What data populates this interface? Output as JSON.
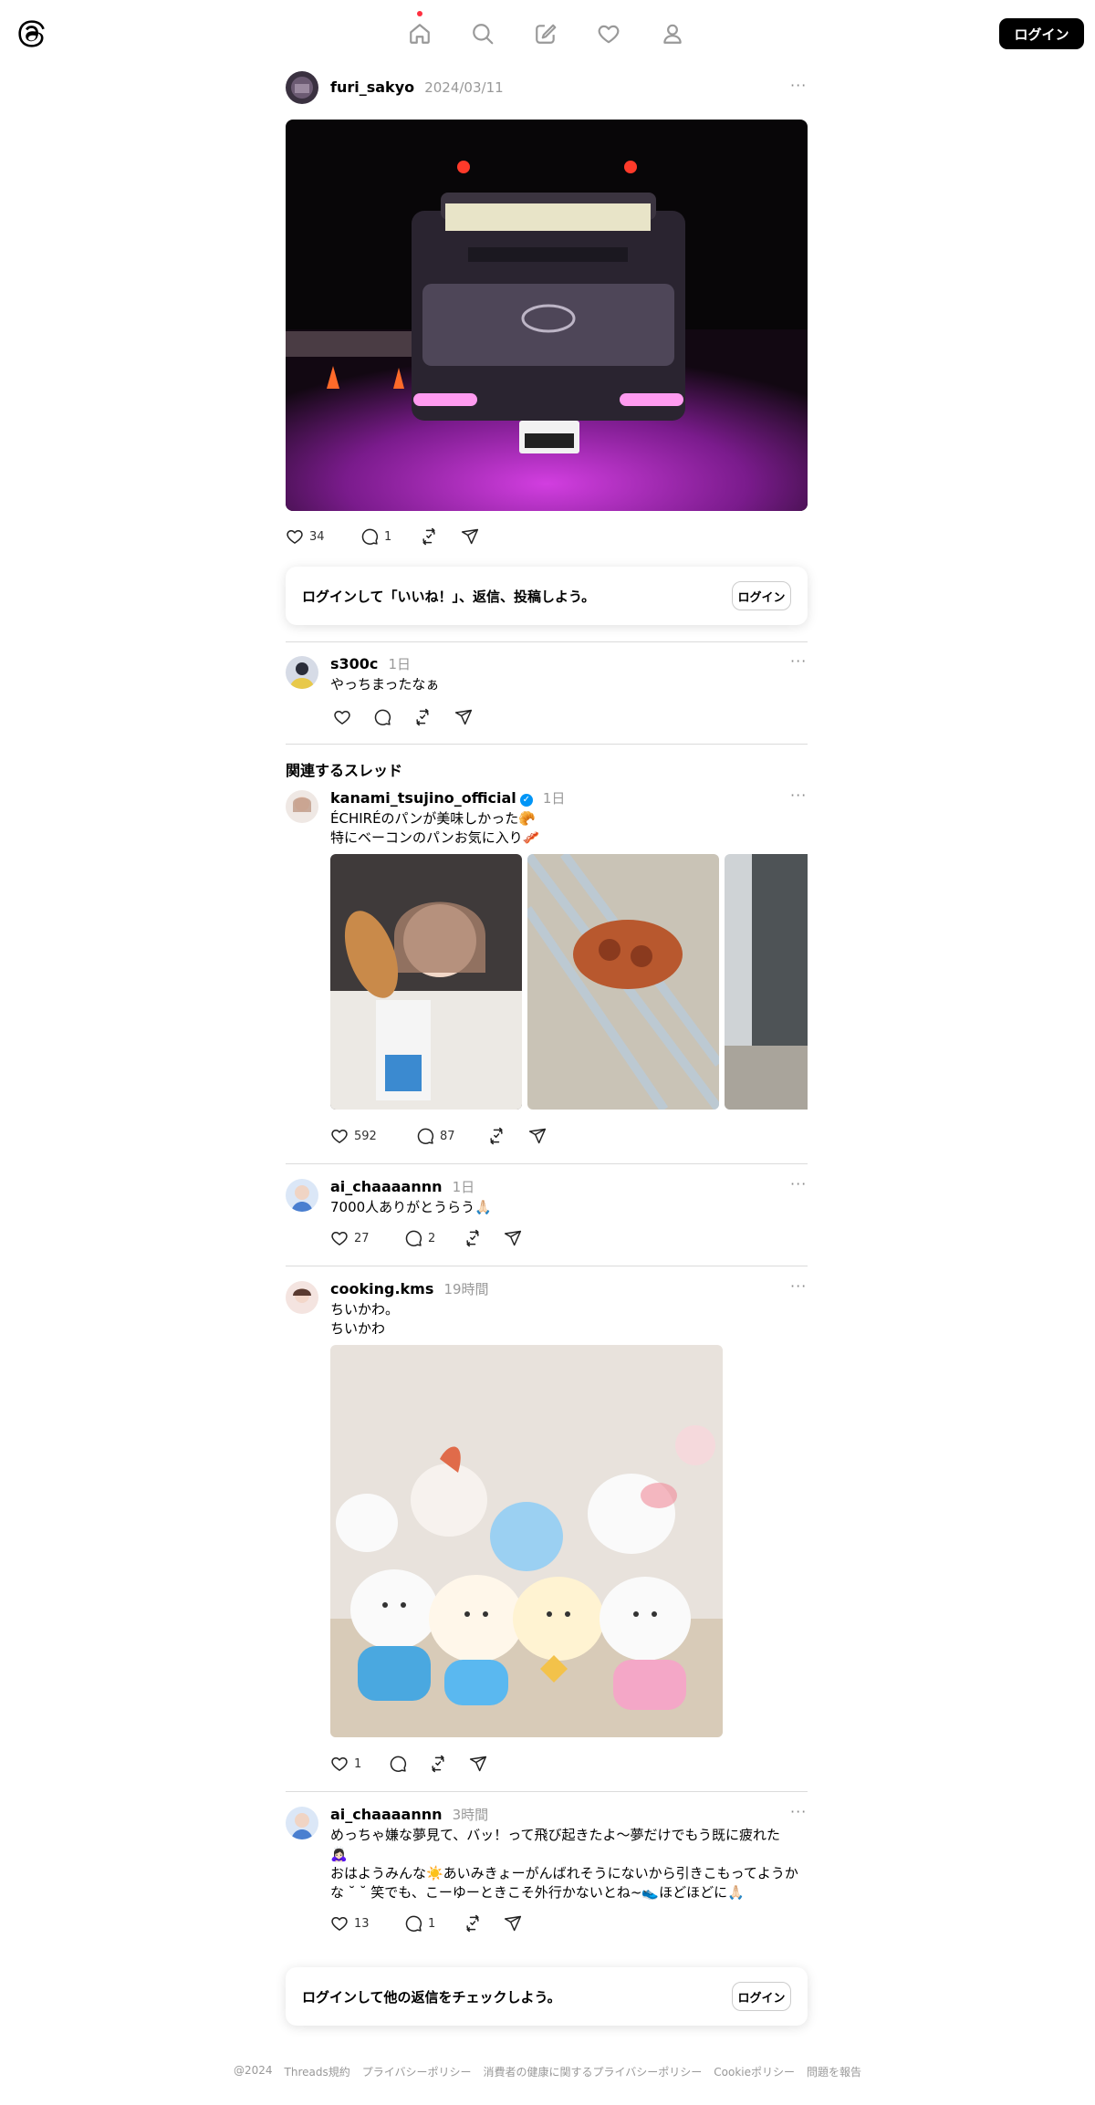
{
  "nav": {
    "login_label": "ログイン",
    "icons": [
      "threads-logo-icon",
      "home-icon",
      "search-icon",
      "compose-icon",
      "heart-icon",
      "profile-icon"
    ]
  },
  "main_post": {
    "username": "furi_sakyo",
    "date": "2024/03/11",
    "more": "···",
    "likes": "34",
    "replies": "1",
    "image_alt": "decorated truck at night with purple lights"
  },
  "login_prompt_1": {
    "message": "ログインして「いいね！」、返信、投稿しよう。",
    "button": "ログイン"
  },
  "reply": {
    "username": "s300c",
    "time": "1日",
    "more": "···",
    "text": "やっちまったなぁ"
  },
  "related": {
    "title": "関連するスレッド",
    "posts": [
      {
        "username": "kanami_tsujino_official",
        "time": "1日",
        "more": "···",
        "line1": "ÉCHIRÉのパンが美味しかった🥐",
        "line2": "特にベーコンのパンお気に入り🥓",
        "likes": "592",
        "replies": "87"
      },
      {
        "username": "ai_chaaaannn",
        "time": "1日",
        "more": "···",
        "line1": "7000人ありがとうらう🙏🏻",
        "likes": "27",
        "replies": "2"
      },
      {
        "username": "cooking.kms",
        "time": "19時間",
        "more": "···",
        "line1": "ちいかわ。",
        "line2": "ちいかわ",
        "likes": "1"
      },
      {
        "username": "ai_chaaaannn",
        "time": "3時間",
        "more": "···",
        "line1": "めっちゃ嫌な夢見て、バッ！って飛び起きたよ〜夢だけでもう既に疲れた",
        "line2": "🙇🏻‍♀️",
        "line3": "おはようみんな☀️あいみきょーがんばれそうにないから引きこもってようか",
        "line4": "な ˘ ˘ 笑でも、こーゆーときこそ外行かないとね~👟ほどほどに🙏🏻",
        "likes": "13",
        "replies": "1"
      }
    ]
  },
  "login_prompt_2": {
    "message": "ログインして他の返信をチェックしよう。",
    "button": "ログイン"
  },
  "footer": {
    "copyright": "@2024",
    "links": [
      "Threads規約",
      "プライバシーポリシー",
      "消費者の健康に関するプライバシーポリシー",
      "Cookieポリシー",
      "問題を報告"
    ]
  },
  "colors": {
    "accent_dot": "#ff3040",
    "verified": "#0095f6",
    "muted": "#999999"
  }
}
